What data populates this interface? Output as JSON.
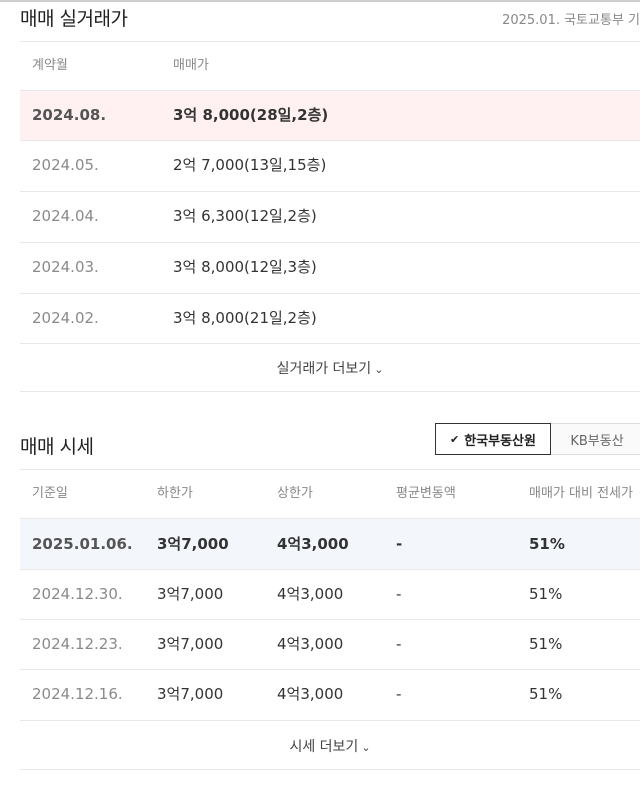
{
  "trade": {
    "title": "매매 실거래가",
    "source": "2025.01. 국토교통부 기",
    "headers": [
      "계약월",
      "매매가"
    ],
    "rows": [
      {
        "month": "2024.08.",
        "price": "3억 8,000(28일,2층)"
      },
      {
        "month": "2024.05.",
        "price": "2억 7,000(13일,15층)"
      },
      {
        "month": "2024.04.",
        "price": "3억 6,300(12일,2층)"
      },
      {
        "month": "2024.03.",
        "price": "3억 8,000(12일,3층)"
      },
      {
        "month": "2024.02.",
        "price": "3억 8,000(21일,2층)"
      }
    ],
    "more_label": "실거래가 더보기",
    "more_icon": "chevron-down"
  },
  "market": {
    "title": "매매 시세",
    "tabs": [
      {
        "label": "한국부동산원",
        "active": true,
        "icon": "check"
      },
      {
        "label": "KB부동산",
        "active": false
      }
    ],
    "headers": [
      "기준일",
      "하한가",
      "상한가",
      "평균변동액",
      "매매가 대비 전세가"
    ],
    "rows": [
      {
        "date": "2025.01.06.",
        "low": "3억7,000",
        "high": "4억3,000",
        "change": "-",
        "ratio": "51%"
      },
      {
        "date": "2024.12.30.",
        "low": "3억7,000",
        "high": "4억3,000",
        "change": "-",
        "ratio": "51%"
      },
      {
        "date": "2024.12.23.",
        "low": "3억7,000",
        "high": "4억3,000",
        "change": "-",
        "ratio": "51%"
      },
      {
        "date": "2024.12.16.",
        "low": "3억7,000",
        "high": "4억3,000",
        "change": "-",
        "ratio": "51%"
      }
    ],
    "more_label": "시세 더보기",
    "more_icon": "chevron-down"
  }
}
